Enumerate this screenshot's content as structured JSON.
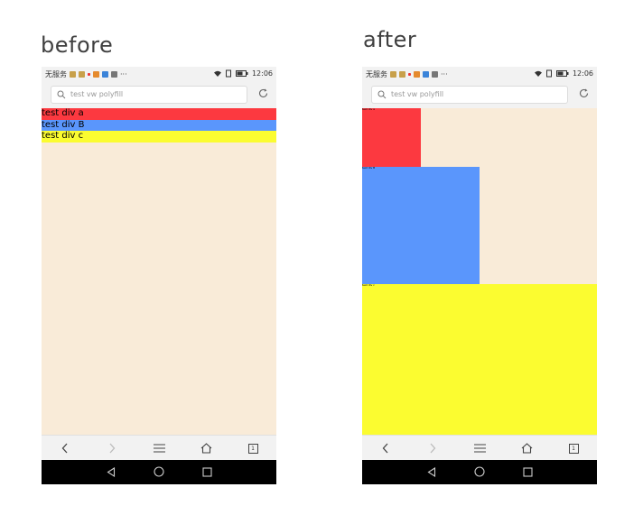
{
  "before": {
    "caption": "before",
    "status": {
      "carrier": "无服务",
      "dots": "···",
      "time": "12:06"
    },
    "search": {
      "placeholder": "test vw polyfill"
    },
    "rows": [
      {
        "label": "test div a",
        "color": "#fc3940"
      },
      {
        "label": "test div B",
        "color": "#5a96fc"
      },
      {
        "label": "test div c",
        "color": "#fbfc30"
      }
    ],
    "page_background": "#f9ebd8",
    "tab_count": "1"
  },
  "after": {
    "caption": "after",
    "status": {
      "carrier": "无服务",
      "dots": "···",
      "time": "12:06"
    },
    "search": {
      "placeholder": "test vw polyfill"
    },
    "boxes": [
      {
        "label": "test div a",
        "color": "#fc3940"
      },
      {
        "label": "test div B",
        "color": "#5a96fc"
      },
      {
        "label": "test div c",
        "color": "#fbfc30"
      }
    ],
    "page_background": "#f9ebd8",
    "tab_count": "1"
  }
}
